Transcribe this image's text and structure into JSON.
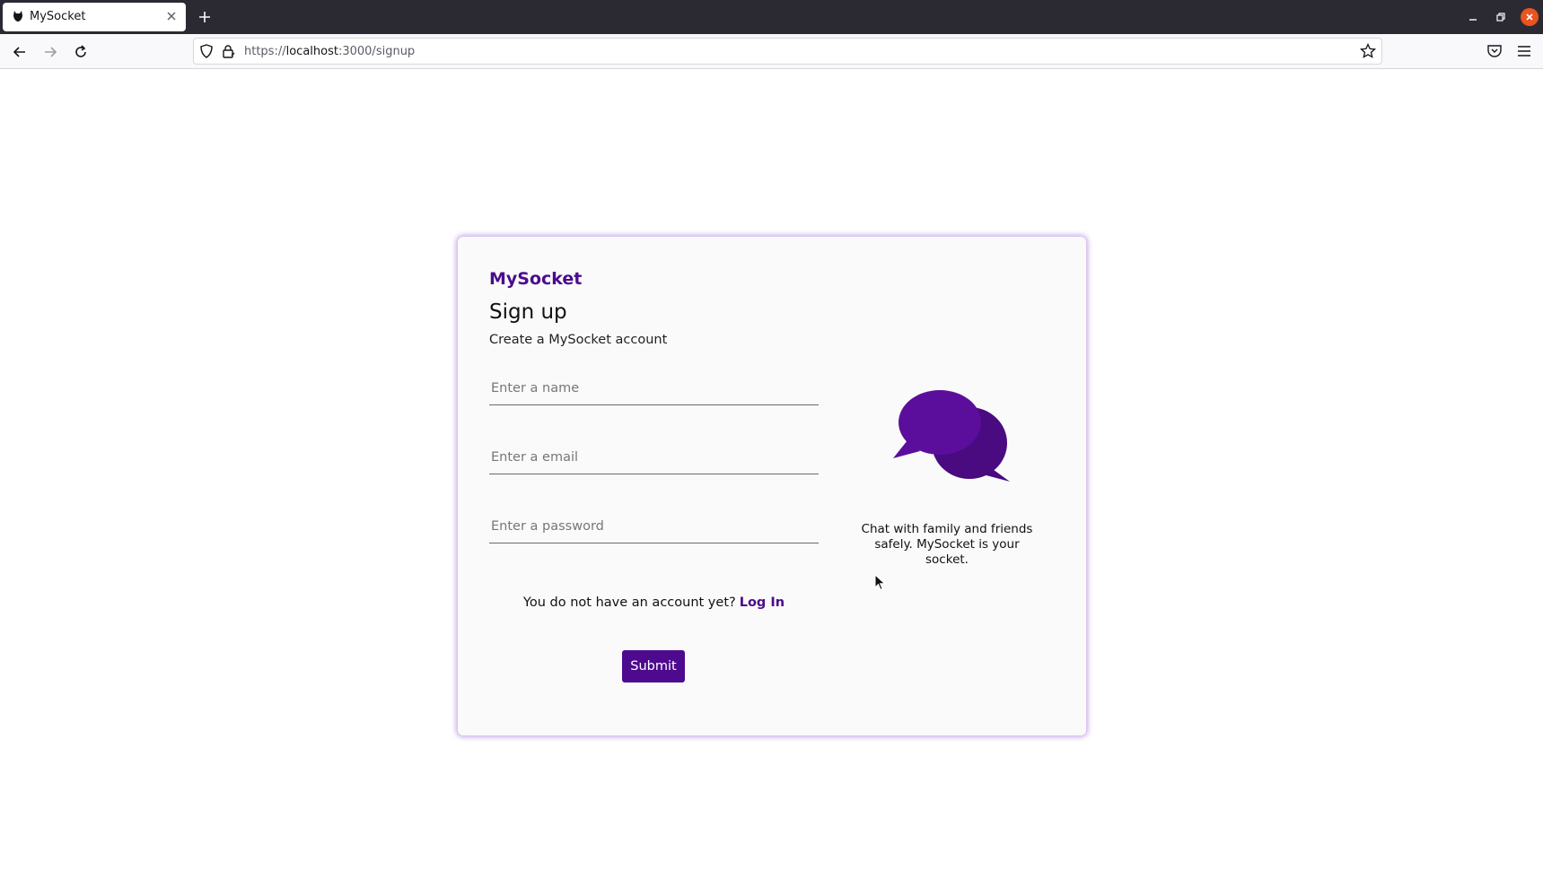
{
  "browser": {
    "tab": {
      "title": "MySocket",
      "favicon": "mysocket-favicon-icon"
    },
    "url": {
      "prefix": "https://",
      "host": "localhost",
      "path": ":3000/signup"
    },
    "icons": {
      "back": "back-arrow-icon",
      "forward": "forward-arrow-icon",
      "reload": "reload-icon",
      "shield": "shield-icon",
      "lock": "lock-icon",
      "bookmark": "star-icon",
      "pocket": "pocket-icon",
      "menu": "hamburger-menu-icon"
    }
  },
  "signup": {
    "brand": "MySocket",
    "heading": "Sign up",
    "subheading": "Create a MySocket account",
    "fields": {
      "name_placeholder": "Enter a name",
      "email_placeholder": "Enter a email",
      "password_placeholder": "Enter a password"
    },
    "login_prompt": "You do not have an account yet?",
    "login_link": "Log In",
    "submit_label": "Submit",
    "tagline": "Chat with family and friends safely. MySocket is your socket."
  },
  "colors": {
    "brand": "#4a0c8c",
    "button": "#4e0a8f",
    "card_bg": "#fafafa",
    "card_glow": "#9a68d6",
    "bubble_front": "#5b0e9c",
    "bubble_back": "#4a0a80",
    "tabbar_bg": "#2b2a33",
    "window_close": "#e95420"
  }
}
